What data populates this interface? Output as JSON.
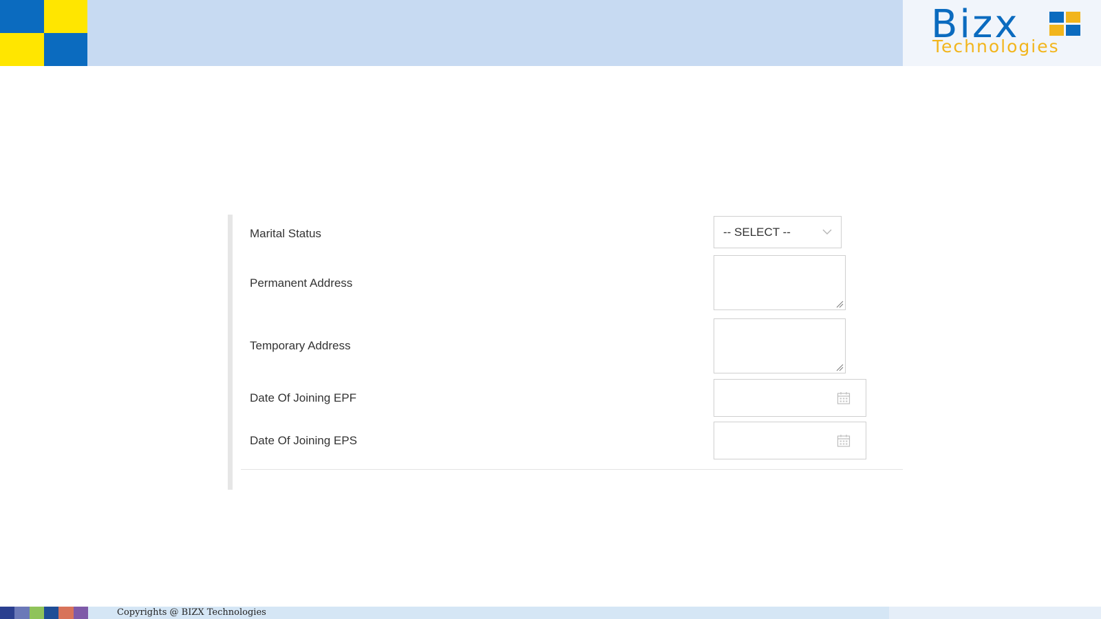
{
  "colors": {
    "brand_blue": "#0b6bbf",
    "brand_yellow": "#ffe600",
    "header_band": "#c7daf2",
    "logo_sub": "#f2b51c"
  },
  "logo": {
    "name": "Bizx",
    "tagline": "Technologies"
  },
  "form": {
    "rows": [
      {
        "label": "Marital Status",
        "type": "select",
        "value": "-- SELECT --"
      },
      {
        "label": "Permanent Address",
        "type": "textarea",
        "value": ""
      },
      {
        "label": "Temporary Address",
        "type": "textarea",
        "value": ""
      },
      {
        "label": "Date Of Joining EPF",
        "type": "date",
        "value": ""
      },
      {
        "label": "Date Of Joining EPS",
        "type": "date",
        "value": ""
      }
    ]
  },
  "footer": {
    "copyright": "Copyrights @ BIZX Technologies",
    "swatches": [
      "#2a3f8f",
      "#6b79b8",
      "#8fc35a",
      "#1f4e96",
      "#d8735a",
      "#7e5aa8"
    ]
  }
}
